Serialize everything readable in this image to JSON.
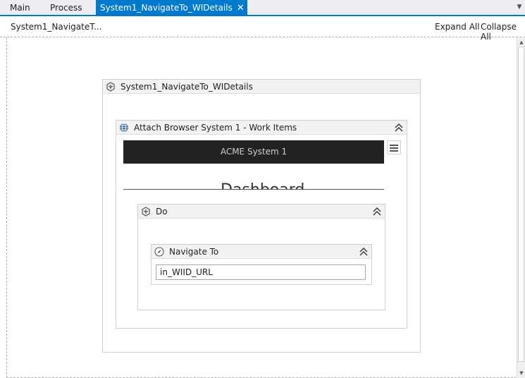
{
  "tabs": {
    "main": "Main",
    "process": "Process",
    "active": "System1_NavigateTo_WIDetails",
    "close_glyph": "✕"
  },
  "toolbar": {
    "breadcrumb": "System1_NavigateT...",
    "expand_all": "Expand All",
    "collapse_all": "Collapse All"
  },
  "workflow": {
    "sequence": {
      "title": "System1_NavigateTo_WIDetails",
      "icon": "sequence-icon"
    },
    "attach_browser": {
      "title": "Attach Browser System 1 - Work Items",
      "icon": "globe-icon",
      "page_header": "ACME System 1",
      "page_title": "Dashboard"
    },
    "do": {
      "title": "Do",
      "icon": "sequence-icon"
    },
    "navigate_to": {
      "title": "Navigate To",
      "icon": "compass-icon",
      "url_value": "in_WIID_URL"
    }
  },
  "colors": {
    "accent": "#007acc",
    "header_bg": "#f2f2f2",
    "browser_bar": "#222222"
  }
}
